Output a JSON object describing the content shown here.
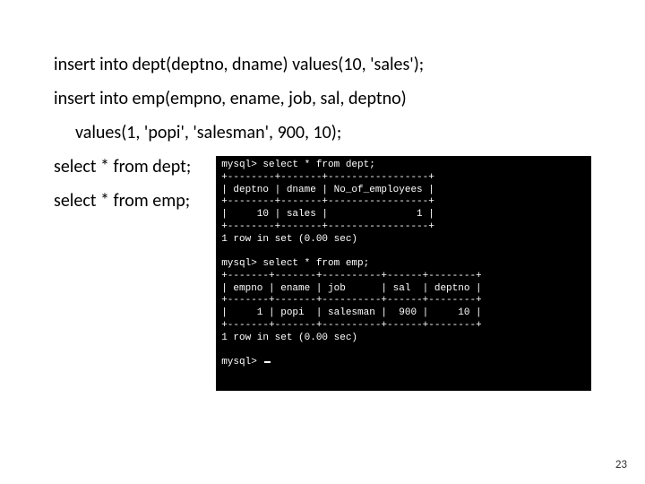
{
  "lines": {
    "l1": "insert into dept(deptno, dname) values(10, 'sales');",
    "l2": "insert into emp(empno, ename, job, sal, deptno)",
    "l3": "values(1, 'popi', 'salesman', 900, 10);",
    "l4": "select * from dept;",
    "l5": "select * from emp;"
  },
  "terminal": {
    "text": "mysql> select * from dept;\n+--------+-------+-----------------+\n| deptno | dname | No_of_employees |\n+--------+-------+-----------------+\n|     10 | sales |               1 |\n+--------+-------+-----------------+\n1 row in set (0.00 sec)\n\nmysql> select * from emp;\n+-------+-------+----------+------+--------+\n| empno | ename | job      | sal  | deptno |\n+-------+-------+----------+------+--------+\n|     1 | popi  | salesman |  900 |     10 |\n+-------+-------+----------+------+--------+\n1 row in set (0.00 sec)\n\nmysql> "
  },
  "page": "23"
}
